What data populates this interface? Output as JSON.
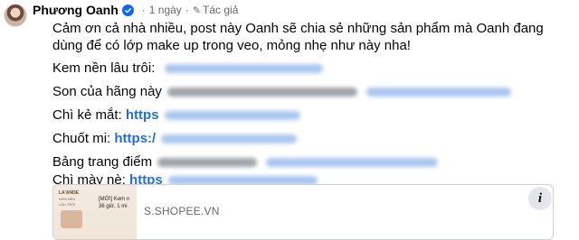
{
  "post": {
    "author": "Phương Oanh",
    "time": "1 ngày",
    "dot": "·",
    "author_tag": "Tác giả",
    "intro": "Cảm ơn cả nhà nhiều, post này Oanh sẽ chia sẻ những sản phẩm mà Oanh đang dùng để có lớp make up trong veo, mỏng nhẹ như này nha!",
    "lines": [
      {
        "label": "Kem nền lâu trôi:",
        "link": ""
      },
      {
        "label": "Son của hãng này",
        "link": ""
      },
      {
        "label": "Chì kẻ mắt:",
        "link": "https"
      },
      {
        "label": "Chuốt mi:",
        "link": "https:/"
      },
      {
        "label": "Bảng trang điểm",
        "link": ""
      },
      {
        "label": "Chì mày nè:",
        "link": "https"
      }
    ]
  },
  "link_preview": {
    "domain": "S.SHOPEE.VN",
    "thumb_caption_1": "[MỚI] Kem n",
    "thumb_caption_2": "36 giờ, 1 mi",
    "info_label": "i"
  },
  "colors": {
    "link": "#216fdb",
    "verified": "#0866ff",
    "meta_text": "#65676b"
  },
  "icons": {
    "verified": "verified-badge-icon",
    "author": "pencil-icon",
    "info": "info-icon"
  }
}
